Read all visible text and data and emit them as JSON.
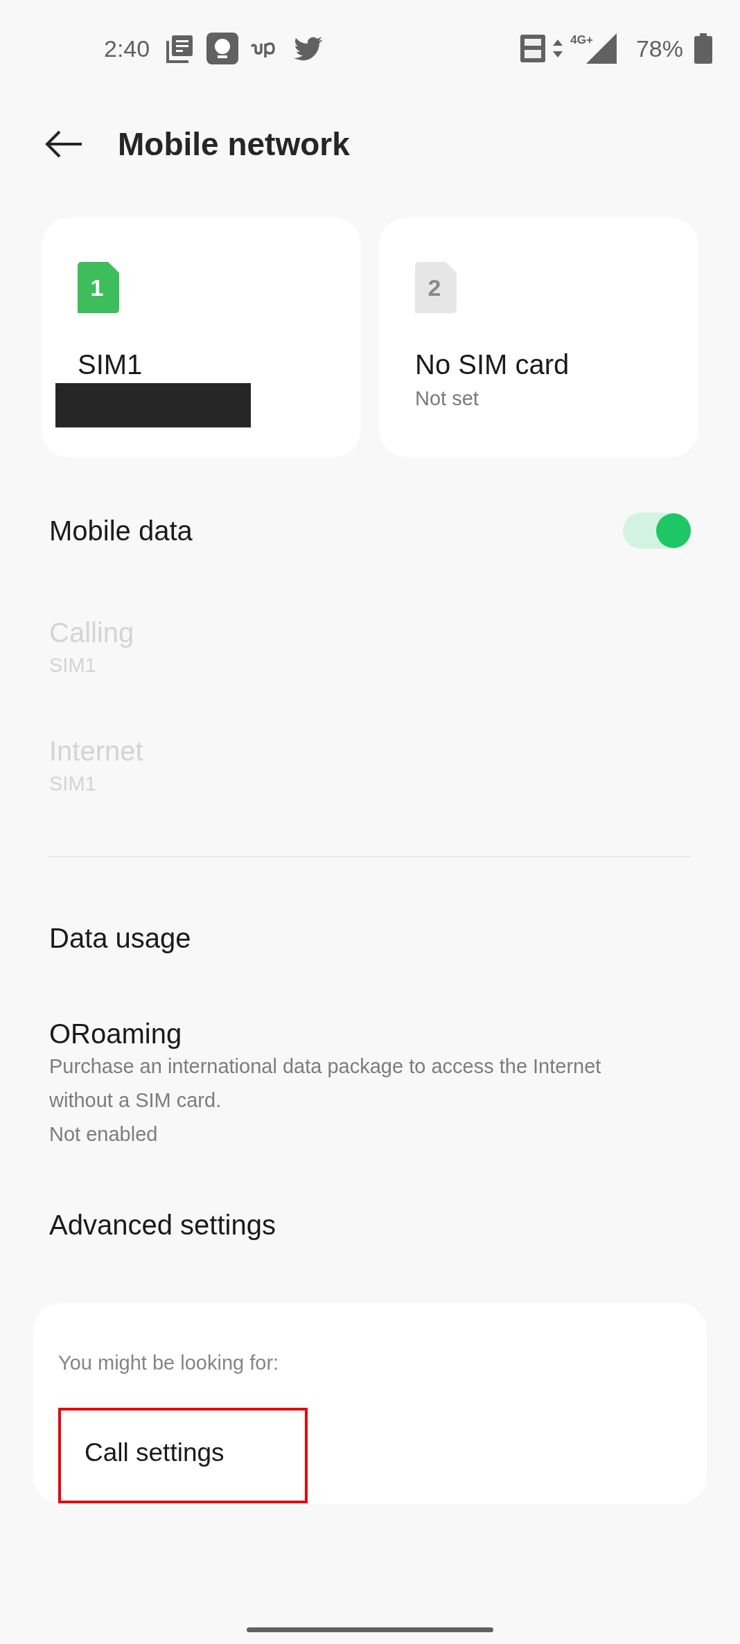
{
  "status_bar": {
    "time": "2:40",
    "network": "4G+",
    "battery": "78%"
  },
  "header": {
    "title": "Mobile network"
  },
  "sims": [
    {
      "slot": "1",
      "name": "SIM1",
      "active": true,
      "redacted": true
    },
    {
      "slot": "2",
      "name": "No SIM card",
      "subtitle": "Not set",
      "active": false,
      "redacted": false
    }
  ],
  "settings": [
    {
      "kind": "toggle",
      "title": "Mobile data",
      "on": true,
      "disabled": false
    },
    {
      "kind": "item",
      "title": "Calling",
      "subtitles": [
        "SIM1"
      ],
      "disabled": true
    },
    {
      "kind": "item",
      "title": "Internet",
      "subtitles": [
        "SIM1"
      ],
      "disabled": true
    },
    {
      "kind": "divider"
    },
    {
      "kind": "item",
      "title": "Data usage",
      "disabled": false
    },
    {
      "kind": "item",
      "title": "ORoaming",
      "subtitles": [
        "Purchase an international data package to access the Internet without a SIM card.",
        "Not enabled"
      ],
      "disabled": false
    },
    {
      "kind": "item",
      "title": "Advanced settings",
      "disabled": false
    }
  ],
  "suggestions": {
    "heading": "You might be looking for:",
    "items": [
      {
        "label": "Call settings",
        "highlighted": true
      }
    ]
  }
}
